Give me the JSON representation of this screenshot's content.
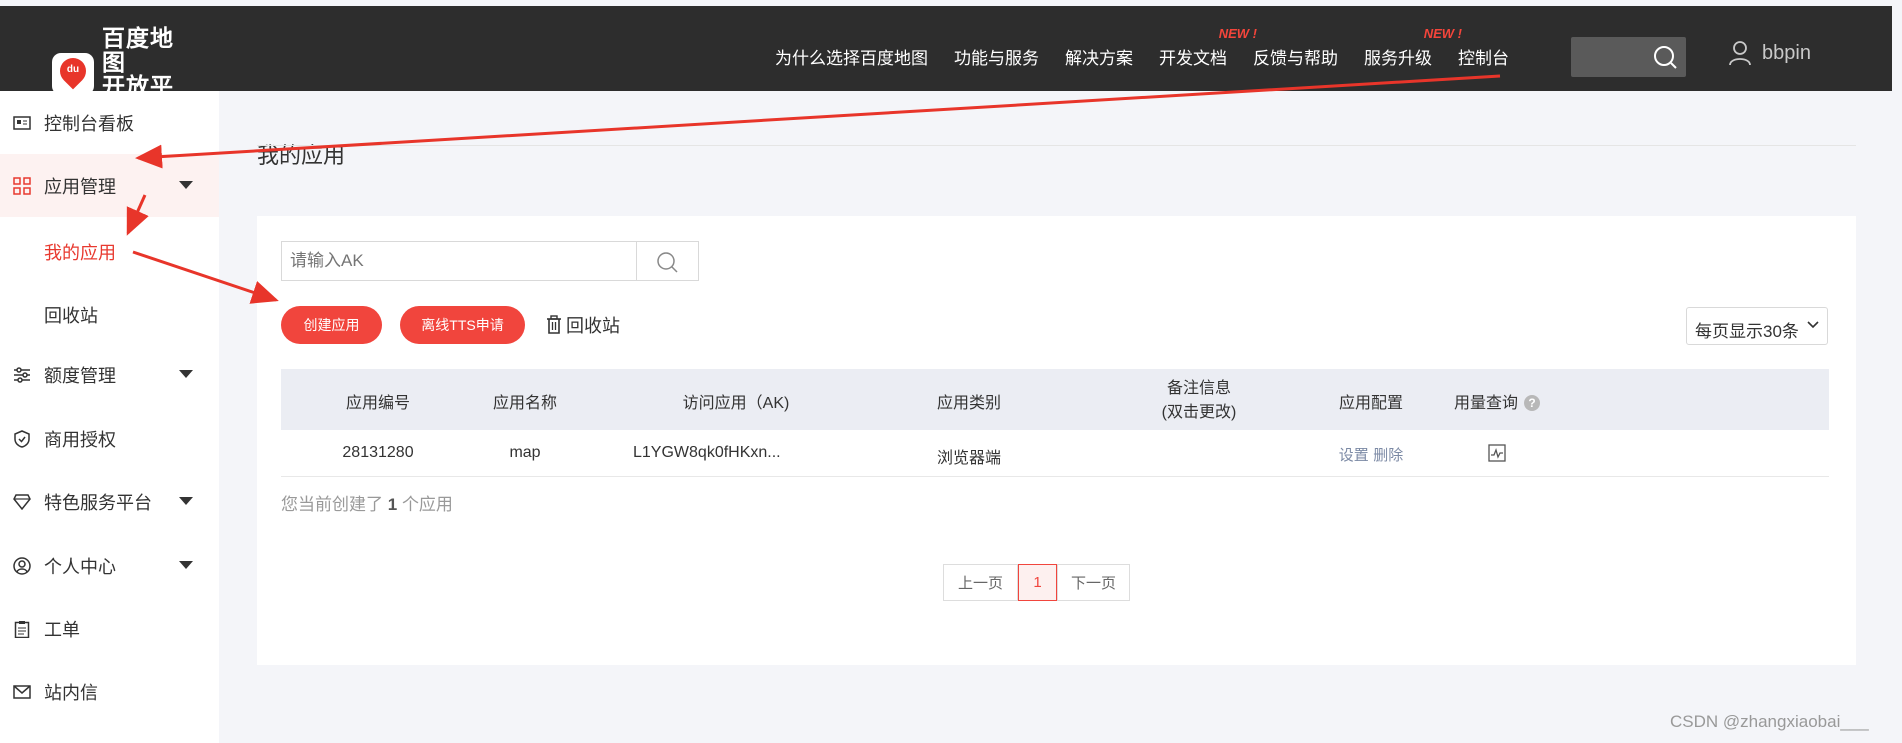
{
  "topbar": {
    "logo_line1": "百度地图",
    "logo_line2": "开放平台",
    "logo_badge": "du",
    "nav": [
      {
        "label": "为什么选择百度地图",
        "badge": ""
      },
      {
        "label": "功能与服务",
        "badge": ""
      },
      {
        "label": "解决方案",
        "badge": ""
      },
      {
        "label": "开发文档",
        "badge": "NEW !"
      },
      {
        "label": "反馈与帮助",
        "badge": ""
      },
      {
        "label": "服务升级",
        "badge": "NEW !"
      },
      {
        "label": "控制台",
        "badge": ""
      }
    ],
    "username": "bbpin"
  },
  "sidebar": {
    "items": [
      {
        "label": "控制台看板",
        "icon": "dashboard-icon"
      },
      {
        "label": "应用管理",
        "icon": "grid-icon"
      },
      {
        "label": "我的应用"
      },
      {
        "label": "回收站"
      },
      {
        "label": "额度管理",
        "icon": "sliders-icon"
      },
      {
        "label": "商用授权",
        "icon": "shield-icon"
      },
      {
        "label": "特色服务平台",
        "icon": "gem-icon"
      },
      {
        "label": "个人中心",
        "icon": "user-circle-icon"
      },
      {
        "label": "工单",
        "icon": "clipboard-icon"
      },
      {
        "label": "站内信",
        "icon": "mail-icon"
      }
    ]
  },
  "main": {
    "title": "我的应用",
    "search_placeholder": "请输入AK",
    "create_button": "创建应用",
    "tts_button": "离线TTS申请",
    "recycle_label": "回收站",
    "per_page": "每页显示30条",
    "table": {
      "headers": [
        "应用编号",
        "应用名称",
        "访问应用（AK)",
        "应用类别",
        "备注信息",
        "(双击更改)",
        "应用配置",
        "用量查询"
      ],
      "rows": [
        {
          "id": "28131280",
          "name": "map",
          "ak": "L1YGW8qk0fHKxn...",
          "category": "浏览器端",
          "note": "",
          "settings": "设置",
          "delete": "删除"
        }
      ]
    },
    "count_prefix": "您当前创建了",
    "count_value": "1",
    "count_suffix": "个应用",
    "pager": {
      "prev": "上一页",
      "current": "1",
      "next": "下一页"
    }
  },
  "watermark": "CSDN @zhangxiaobai___",
  "colors": {
    "accent": "#f1453d",
    "topbar": "#2d2d2d",
    "annotation": "#e8352a"
  }
}
